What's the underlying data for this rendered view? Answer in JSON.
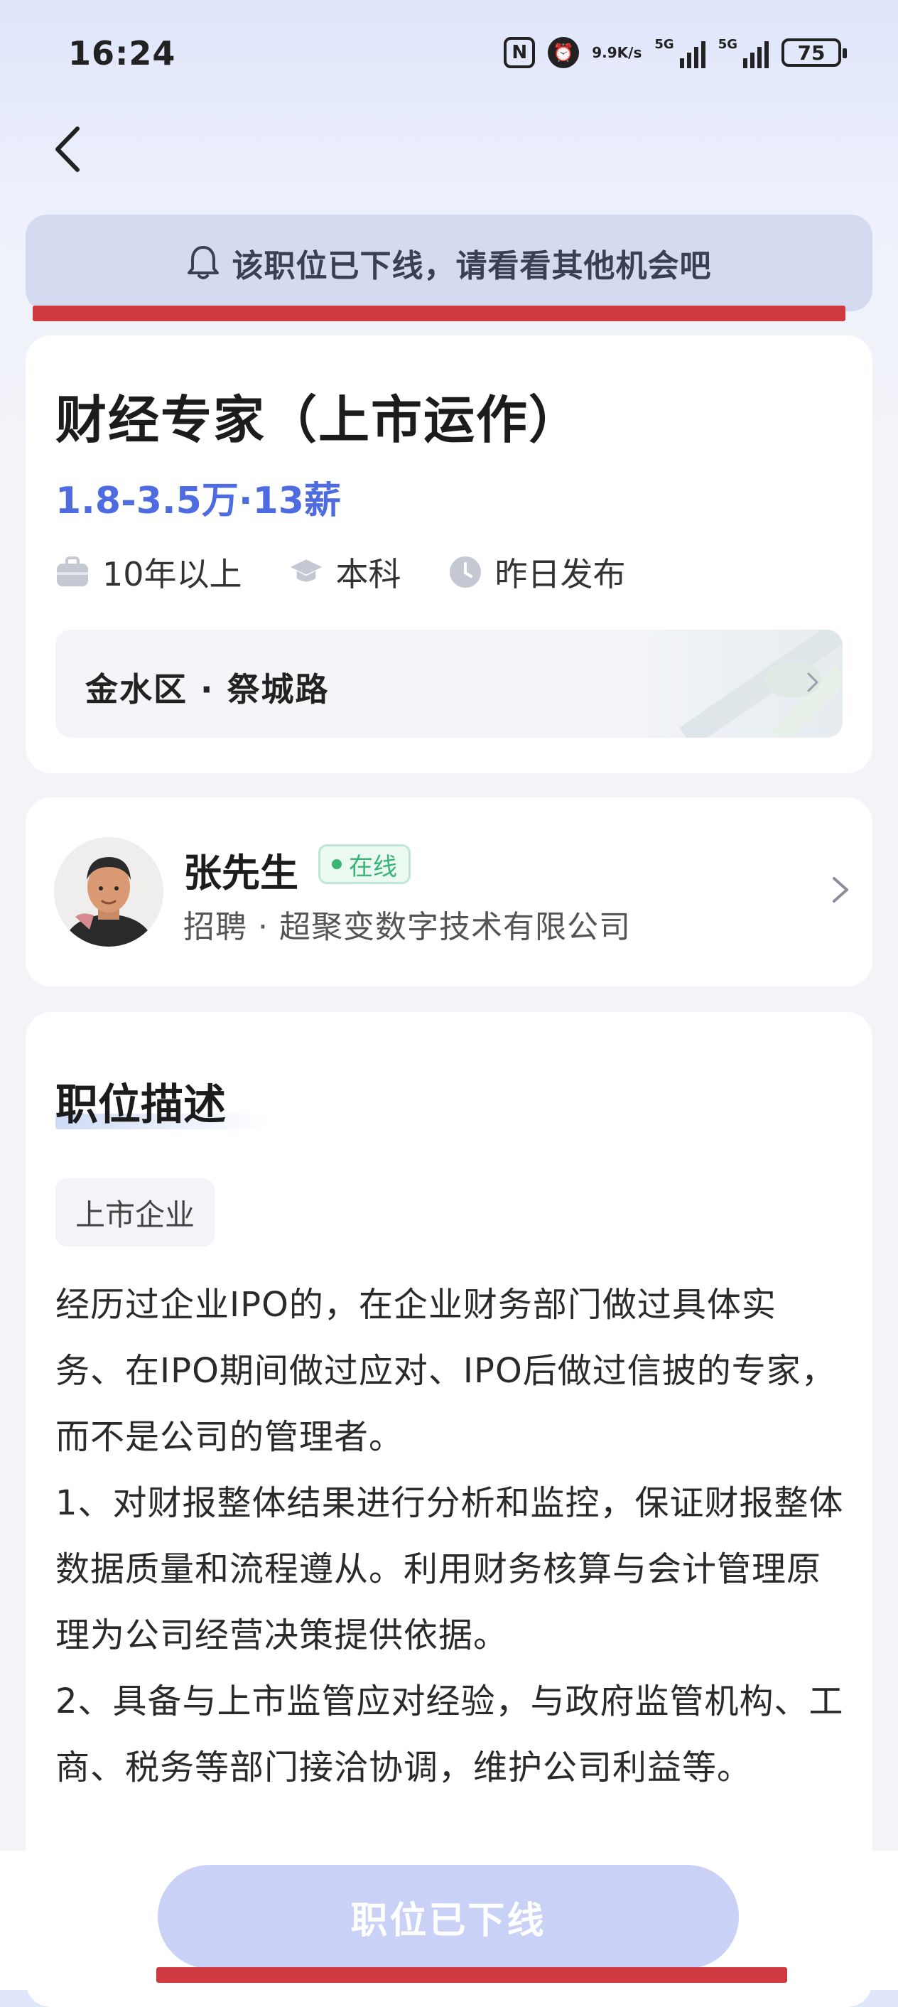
{
  "status_bar": {
    "time": "16:24",
    "nfc_icon": "N",
    "net_speed_value": "9.9",
    "net_speed_unit": "K/s",
    "sig1_label": "5G",
    "sig2_label": "5G",
    "battery": "75"
  },
  "banner": {
    "text": "该职位已下线，请看看其他机会吧",
    "icon": "bell-icon"
  },
  "job": {
    "title": "财经专家（上市运作）",
    "salary": "1.8-3.5万·13薪",
    "experience": "10年以上",
    "education": "本科",
    "posted": "昨日发布",
    "location": "金水区 · 祭城路"
  },
  "recruiter": {
    "name": "张先生",
    "status": "在线",
    "company": "招聘 · 超聚变数字技术有限公司"
  },
  "description": {
    "title": "职位描述",
    "tag": "上市企业",
    "body": "经历过企业IPO的，在企业财务部门做过具体实务、在IPO期间做过应对、IPO后做过信披的专家，而不是公司的管理者。\n1、对财报整体结果进行分析和监控，保证财报整体数据质量和流程遵从。利用财务核算与会计管理原理为公司经营决策提供依据。\n2、具备与上市监管应对经验，与政府监管机构、工商、税务等部门接洽协调，维护公司利益等。"
  },
  "bottom": {
    "button_label": "职位已下线"
  },
  "colors": {
    "accent": "#4e6bdf",
    "online_green": "#3bb277",
    "annotation_red": "#d0393f",
    "disabled_button": "#c9d2f6"
  }
}
